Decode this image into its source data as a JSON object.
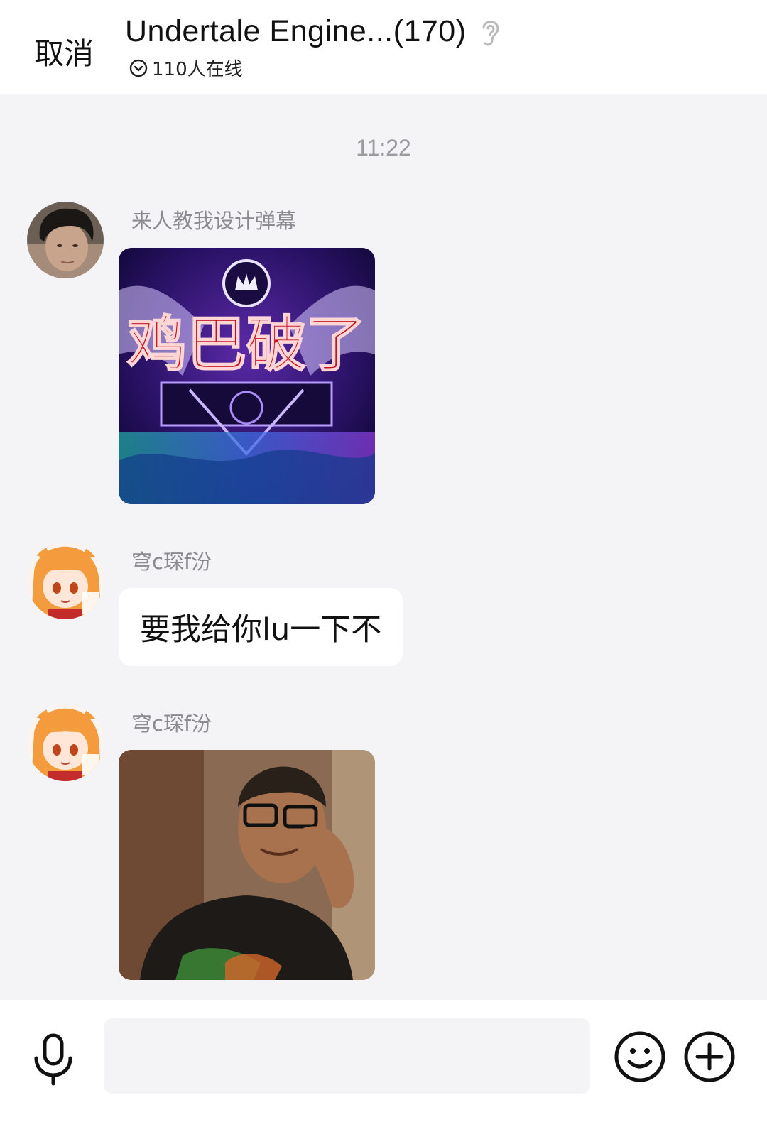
{
  "header": {
    "cancel_label": "取消",
    "title": "Undertale Engine...(170)",
    "online_text": "110人在线"
  },
  "chat": {
    "timestamp": "11:22",
    "messages": [
      {
        "sender": "来人教我设计弹幕",
        "type": "image",
        "image_text": "鸡巴破了"
      },
      {
        "sender": "穹c琛f汾",
        "type": "text",
        "text": "要我给你lu一下不"
      },
      {
        "sender": "穹c琛f汾",
        "type": "image"
      }
    ]
  },
  "input": {
    "placeholder": ""
  },
  "colors": {
    "header_bg": "#ffffff",
    "chat_bg": "#f4f4f7",
    "bubble_bg": "#ffffff",
    "muted_text": "#8a8a90"
  },
  "icons": [
    "ear-icon",
    "check-circle-icon",
    "mic-icon",
    "emoji-icon",
    "plus-circle-icon"
  ]
}
